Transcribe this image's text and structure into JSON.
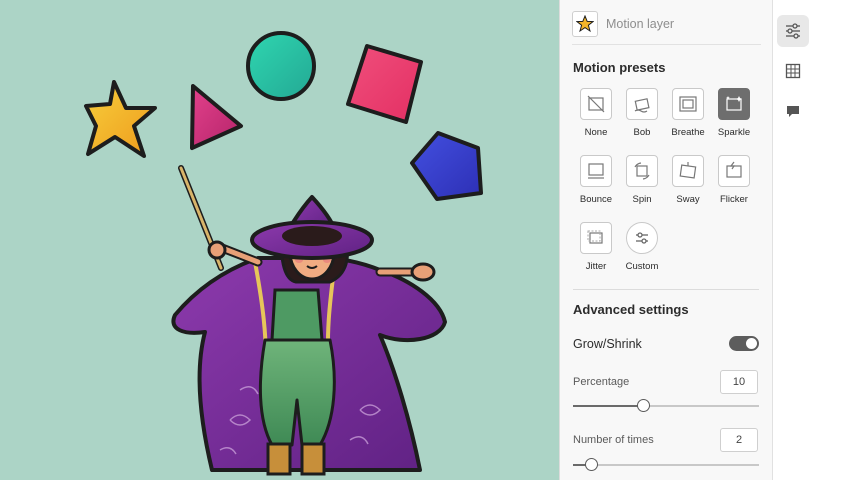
{
  "layer": {
    "name": "Motion layer",
    "thumbnail_icon": "star-thumbnail-icon"
  },
  "motion_presets": {
    "title": "Motion presets",
    "selected": "Sparkle",
    "items": [
      {
        "label": "None",
        "icon": "no-motion-icon"
      },
      {
        "label": "Bob",
        "icon": "bob-icon"
      },
      {
        "label": "Breathe",
        "icon": "breathe-icon"
      },
      {
        "label": "Sparkle",
        "icon": "sparkle-icon"
      },
      {
        "label": "Bounce",
        "icon": "bounce-icon"
      },
      {
        "label": "Spin",
        "icon": "spin-icon"
      },
      {
        "label": "Sway",
        "icon": "sway-icon"
      },
      {
        "label": "Flicker",
        "icon": "flicker-icon"
      },
      {
        "label": "Jitter",
        "icon": "jitter-icon"
      },
      {
        "label": "Custom",
        "icon": "custom-sliders-icon"
      }
    ]
  },
  "advanced": {
    "title": "Advanced settings",
    "grow_shrink": {
      "label": "Grow/Shrink",
      "enabled": true
    },
    "percentage": {
      "label": "Percentage",
      "value": "10",
      "slider_fraction": 0.38
    },
    "times": {
      "label": "Number of times",
      "value": "2",
      "slider_fraction": 0.1
    }
  },
  "rail": {
    "items": [
      "adjustments-icon",
      "grid-icon",
      "comment-icon"
    ]
  },
  "colors": {
    "canvas_bg": "#acd4c6",
    "panel_bg": "#f8f8f8",
    "selected_tile": "#6e6e6e",
    "star": "#f3b52a",
    "triangle": "#d8337a",
    "circle": "#2dc6a4",
    "diamond": "#ee4272",
    "pentagon": "#3b3fcf",
    "robe": "#7a2f9a"
  }
}
